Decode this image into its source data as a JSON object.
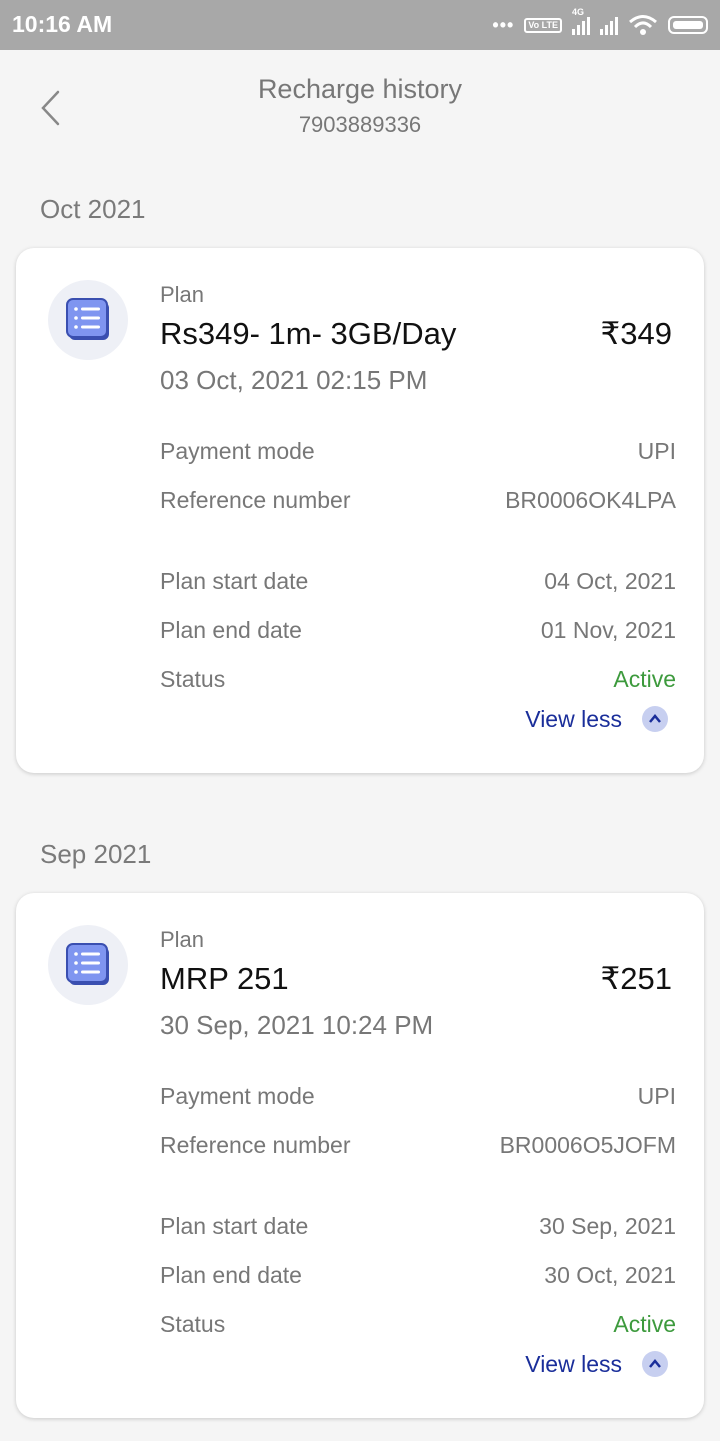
{
  "status_bar": {
    "time": "10:16 AM",
    "dots": "•••",
    "volte": "Vo LTE",
    "network_label": "4G"
  },
  "header": {
    "title": "Recharge history",
    "number": "7903889336"
  },
  "labels": {
    "plan": "Plan",
    "payment_mode": "Payment mode",
    "reference_number": "Reference number",
    "plan_start_date": "Plan start date",
    "plan_end_date": "Plan end date",
    "status": "Status",
    "view_less": "View less"
  },
  "groups": [
    {
      "month": "Oct 2021",
      "plan_name": "Rs349- 1m- 3GB/Day",
      "price": "₹349",
      "datetime": "03 Oct, 2021 02:15 PM",
      "payment_mode": "UPI",
      "reference_number": "BR0006OK4LPA",
      "plan_start_date": "04 Oct, 2021",
      "plan_end_date": "01 Nov, 2021",
      "status": "Active"
    },
    {
      "month": "Sep 2021",
      "plan_name": "MRP 251",
      "price": "₹251",
      "datetime": "30 Sep, 2021 10:24 PM",
      "payment_mode": "UPI",
      "reference_number": "BR0006O5JOFM",
      "plan_start_date": "30 Sep, 2021",
      "plan_end_date": "30 Oct, 2021",
      "status": "Active"
    }
  ],
  "colors": {
    "status_active": "#3d9a3d",
    "link": "#1a2e9a",
    "icon_blue": "#7f95f0"
  }
}
